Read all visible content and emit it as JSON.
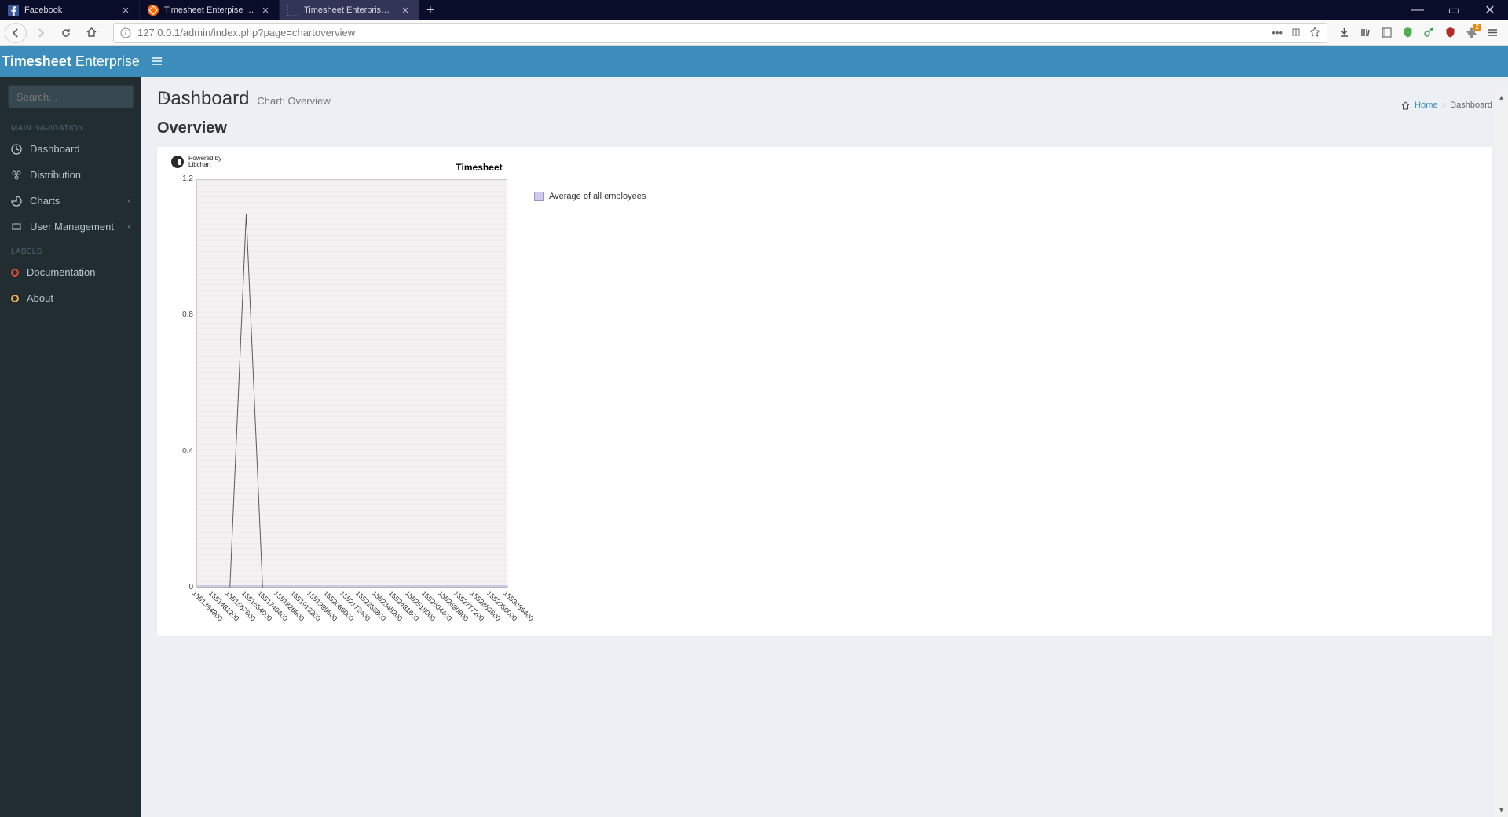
{
  "browser": {
    "tabs": [
      {
        "label": "Facebook",
        "favicon": "facebook"
      },
      {
        "label": "Timesheet Enterpise / Code / [",
        "favicon": "sourceforge"
      },
      {
        "label": "Timesheet Enterprise | Dashboard",
        "favicon": "none"
      }
    ],
    "active_tab": 2,
    "url": "127.0.0.1/admin/index.php?page=chartoverview"
  },
  "app": {
    "brand_bold": "Timesheet",
    "brand_light": "Enterprise",
    "search_placeholder": "Search...",
    "nav_header": "MAIN NAVIGATION",
    "nav": [
      {
        "icon": "dashboard",
        "label": "Dashboard",
        "expand": false
      },
      {
        "icon": "distribution",
        "label": "Distribution",
        "expand": false
      },
      {
        "icon": "charts",
        "label": "Charts",
        "expand": true
      },
      {
        "icon": "users",
        "label": "User Management",
        "expand": true
      }
    ],
    "labels_header": "LABELS",
    "labels": [
      {
        "color": "#dd4b39",
        "label": "Documentation"
      },
      {
        "color": "#f0ad4e",
        "label": "About"
      }
    ]
  },
  "page": {
    "title": "Dashboard",
    "subtitle": "Chart: Overview",
    "section": "Overview",
    "crumb_home": "Home",
    "crumb_current": "Dashboard"
  },
  "chart_data": {
    "type": "line",
    "title": "Timesheet",
    "powered_by": "Powered by\nLibchart",
    "legend": "Average of all employees",
    "ylim": [
      0,
      1.2
    ],
    "yticks": [
      0,
      0.4,
      0.8,
      1.2
    ],
    "x": [
      "1551394800",
      "1551481200",
      "1551567600",
      "1551654000",
      "1551740400",
      "1551826800",
      "1551913200",
      "1551999600",
      "1552086000",
      "1552172400",
      "1552258800",
      "1552345200",
      "1552431600",
      "1552518000",
      "1552604400",
      "1552690800",
      "1552777200",
      "1552863600",
      "1552950000",
      "1553036400"
    ],
    "series": [
      {
        "name": "Average of all employees",
        "values": [
          0,
          0,
          0,
          1.1,
          0,
          0,
          0,
          0,
          0,
          0,
          0,
          0,
          0,
          0,
          0,
          0,
          0,
          0,
          0,
          0
        ]
      }
    ]
  }
}
